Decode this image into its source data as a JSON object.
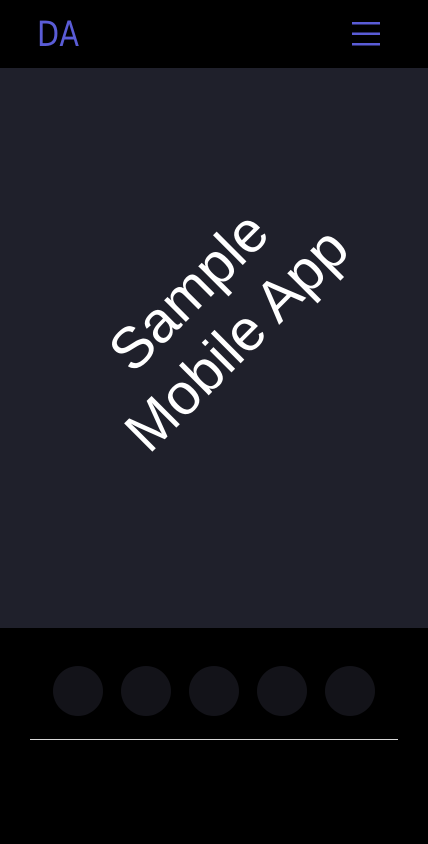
{
  "header": {
    "logo_text": "DA",
    "menu_icon": "hamburger-menu-icon"
  },
  "hero": {
    "line1": "Sample",
    "line2": "Mobile App"
  },
  "dots": {
    "count": 5
  },
  "colors": {
    "background": "#000000",
    "hero_background": "#1f202b",
    "accent": "#5a5cd6",
    "hero_text": "#ffffff",
    "dot": "#131319",
    "divider": "#d8d8d8"
  }
}
